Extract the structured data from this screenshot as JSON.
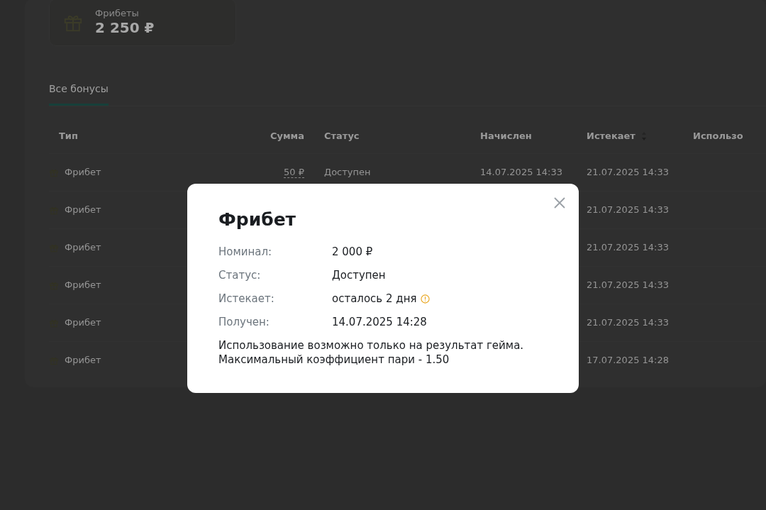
{
  "summary_card": {
    "label": "Фрибеты",
    "value": "2 250 ₽"
  },
  "tabs": [
    {
      "label": "Все бонусы",
      "selected": true
    }
  ],
  "table": {
    "columns": [
      {
        "label": "Тип",
        "sortable": false
      },
      {
        "label": "Сумма",
        "sortable": false
      },
      {
        "label": "Статус",
        "sortable": false
      },
      {
        "label": "Начислен",
        "sortable": false
      },
      {
        "label": "Истекает",
        "sortable": true
      },
      {
        "label": "Использо",
        "sortable": false
      }
    ],
    "rows": [
      {
        "type": "Фрибет",
        "amount": "50 ₽",
        "status": "Доступен",
        "credited": "14.07.2025 14:33",
        "expires": "21.07.2025 14:33"
      },
      {
        "type": "Фрибет",
        "expires": "21.07.2025 14:33"
      },
      {
        "type": "Фрибет",
        "expires": "21.07.2025 14:33"
      },
      {
        "type": "Фрибет",
        "expires": "21.07.2025 14:33"
      },
      {
        "type": "Фрибет",
        "expires": "21.07.2025 14:33"
      },
      {
        "type": "Фрибет",
        "expires": "17.07.2025 14:28"
      }
    ]
  },
  "modal": {
    "title": "Фрибет",
    "fields": [
      {
        "label": "Номинал:",
        "value": "2 000 ₽",
        "warning": false
      },
      {
        "label": "Статус:",
        "value": "Доступен",
        "warning": false
      },
      {
        "label": "Истекает:",
        "value": "осталось 2 дня",
        "warning": true
      },
      {
        "label": "Получен:",
        "value": "14.07.2025 14:28",
        "warning": false
      }
    ],
    "note": "Использование возможно только на результат гейма.\nМаксимальный коэффициент пари - 1.50"
  }
}
